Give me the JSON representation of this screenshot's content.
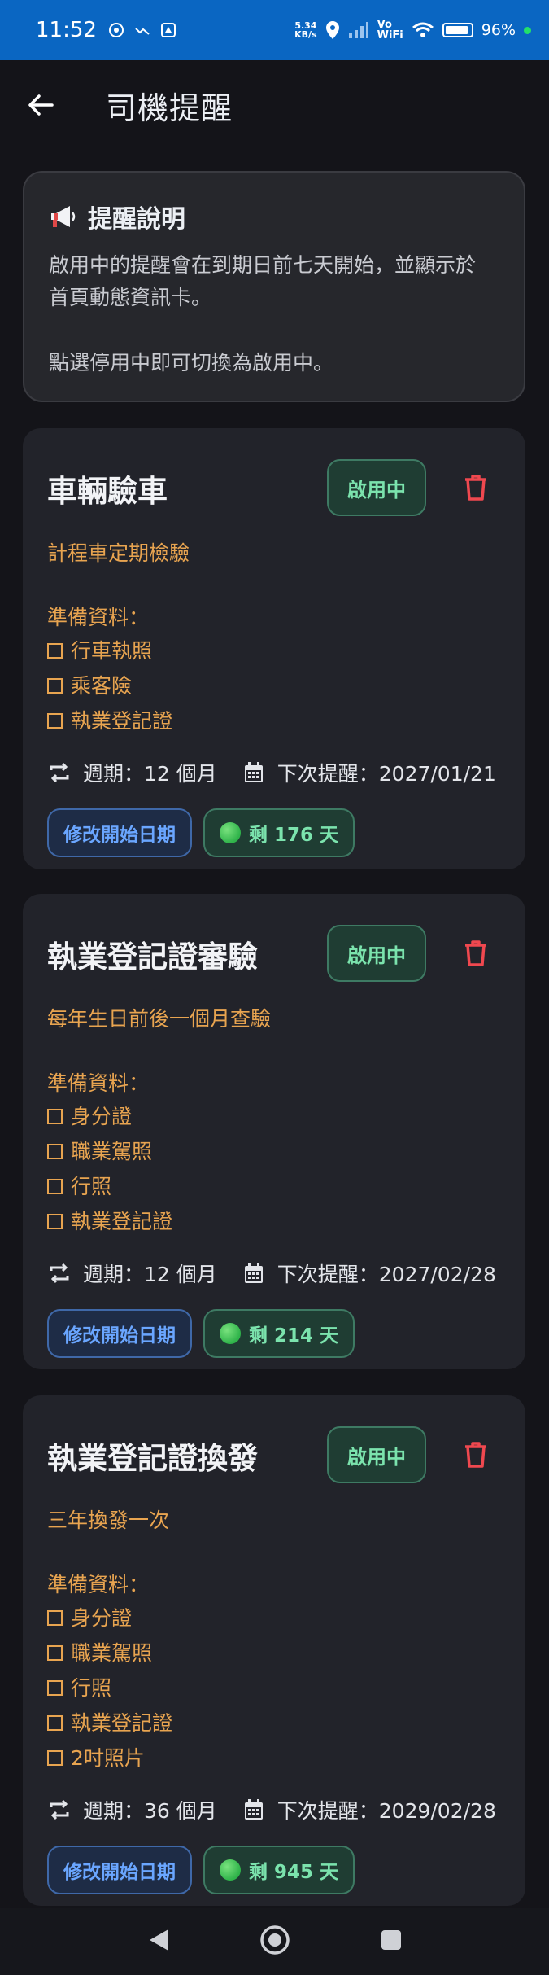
{
  "status": {
    "time": "11:52",
    "speed_value": "5.34",
    "speed_unit": "KB/s",
    "volte_top": "Vo",
    "volte_bottom": "WiFi",
    "battery": "96%"
  },
  "appbar": {
    "title": "司機提醒"
  },
  "info": {
    "title": "提醒說明",
    "line1": "啟用中的提醒會在到期日前七天開始，並顯示於",
    "line2": "首頁動態資訊卡。",
    "line3": "點選停用中即可切換為啟用中。"
  },
  "reminders": [
    {
      "title": "車輛驗車",
      "toggle": "啟用中",
      "subtitle": "計程車定期檢驗",
      "prep_label": "準備資料：",
      "items": [
        "行車執照",
        "乘客險",
        "執業登記證"
      ],
      "cycle": "週期：12 個月",
      "next": "下次提醒：2027/01/21",
      "edit_label": "修改開始日期",
      "remaining": "剩 176 天"
    },
    {
      "title": "執業登記證審驗",
      "toggle": "啟用中",
      "subtitle": "每年生日前後一個月查驗",
      "prep_label": "準備資料：",
      "items": [
        "身分證",
        "職業駕照",
        "行照",
        "執業登記證"
      ],
      "cycle": "週期：12 個月",
      "next": "下次提醒：2027/02/28",
      "edit_label": "修改開始日期",
      "remaining": "剩 214 天"
    },
    {
      "title": "執業登記證換發",
      "toggle": "啟用中",
      "subtitle": "三年換發一次",
      "prep_label": "準備資料：",
      "items": [
        "身分證",
        "職業駕照",
        "行照",
        "執業登記證",
        "2吋照片"
      ],
      "cycle": "週期：36 個月",
      "next": "下次提醒：2029/02/28",
      "edit_label": "修改開始日期",
      "remaining": "剩 945 天"
    }
  ],
  "colors": {
    "accent_orange": "#e8a450",
    "enabled_green": "#7be3ad",
    "delete_red": "#f0484f",
    "chip_blue": "#6aa6ff",
    "statusbar_blue": "#0a66c2"
  }
}
